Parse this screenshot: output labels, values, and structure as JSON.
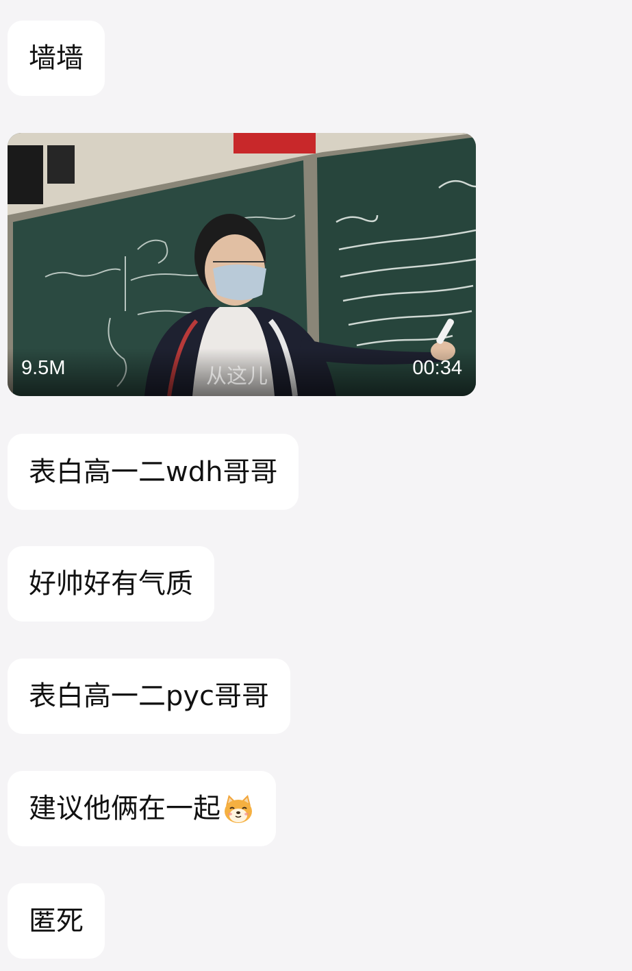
{
  "messages": [
    {
      "text": "墙墙"
    },
    {
      "video": {
        "size": "9.5M",
        "duration": "00:34",
        "watermark": "从这儿"
      }
    },
    {
      "text": "表白高一二wdh哥哥"
    },
    {
      "text": "好帅好有气质"
    },
    {
      "text": "表白高一二pyc哥哥"
    },
    {
      "text": "建议他俩在一起",
      "emoji": "dog-face-emoji"
    },
    {
      "text": "匿死"
    }
  ],
  "colors": {
    "background": "#f5f4f6",
    "bubble": "#ffffff",
    "text": "#111111"
  }
}
